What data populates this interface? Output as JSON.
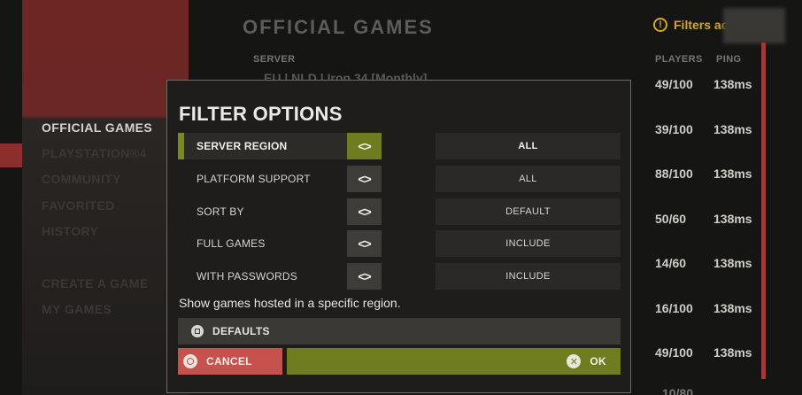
{
  "background": {
    "title": "OFFICIAL GAMES",
    "headers": {
      "server": "SERVER",
      "players": "PLAYERS",
      "ping": "PING"
    },
    "partial_server": "EU | NLD | Iron 34 [Monthly]",
    "filters_indicator": "Filters ac",
    "bottom_peek": "10/80",
    "sidebar": [
      {
        "label": "OFFICIAL GAMES",
        "active": true
      },
      {
        "label": "PLAYSTATION®4",
        "active": false
      },
      {
        "label": "COMMUNITY",
        "active": false
      },
      {
        "label": "FAVORITED",
        "active": false
      },
      {
        "label": "HISTORY",
        "active": false
      },
      {
        "label": "CREATE A GAME",
        "active": false
      },
      {
        "label": "MY GAMES",
        "active": false
      }
    ],
    "servers": [
      {
        "players": "49/100",
        "ping": "138ms"
      },
      {
        "players": "39/100",
        "ping": "138ms"
      },
      {
        "players": "88/100",
        "ping": "138ms"
      },
      {
        "players": "50/60",
        "ping": "138ms"
      },
      {
        "players": "14/60",
        "ping": "138ms"
      },
      {
        "players": "16/100",
        "ping": "138ms"
      },
      {
        "players": "49/100",
        "ping": "138ms"
      }
    ]
  },
  "modal": {
    "title": "FILTER OPTIONS",
    "options": [
      {
        "label": "SERVER REGION",
        "value": "ALL",
        "active": true
      },
      {
        "label": "PLATFORM SUPPORT",
        "value": "ALL",
        "active": false
      },
      {
        "label": "SORT BY",
        "value": "DEFAULT",
        "active": false
      },
      {
        "label": "FULL GAMES",
        "value": "INCLUDE",
        "active": false
      },
      {
        "label": "WITH PASSWORDS",
        "value": "INCLUDE",
        "active": false
      }
    ],
    "toggle_glyph": "<>",
    "description": "Show games hosted in a specific region.",
    "defaults_label": "DEFAULTS",
    "cancel_label": "CANCEL",
    "ok_label": "OK",
    "ok_icon_glyph": "✕"
  },
  "colors": {
    "accent_green": "#6f7d20",
    "cancel_red": "#c5524c",
    "sidebar_red": "#6e2624",
    "filters_yellow": "#d3a626"
  }
}
